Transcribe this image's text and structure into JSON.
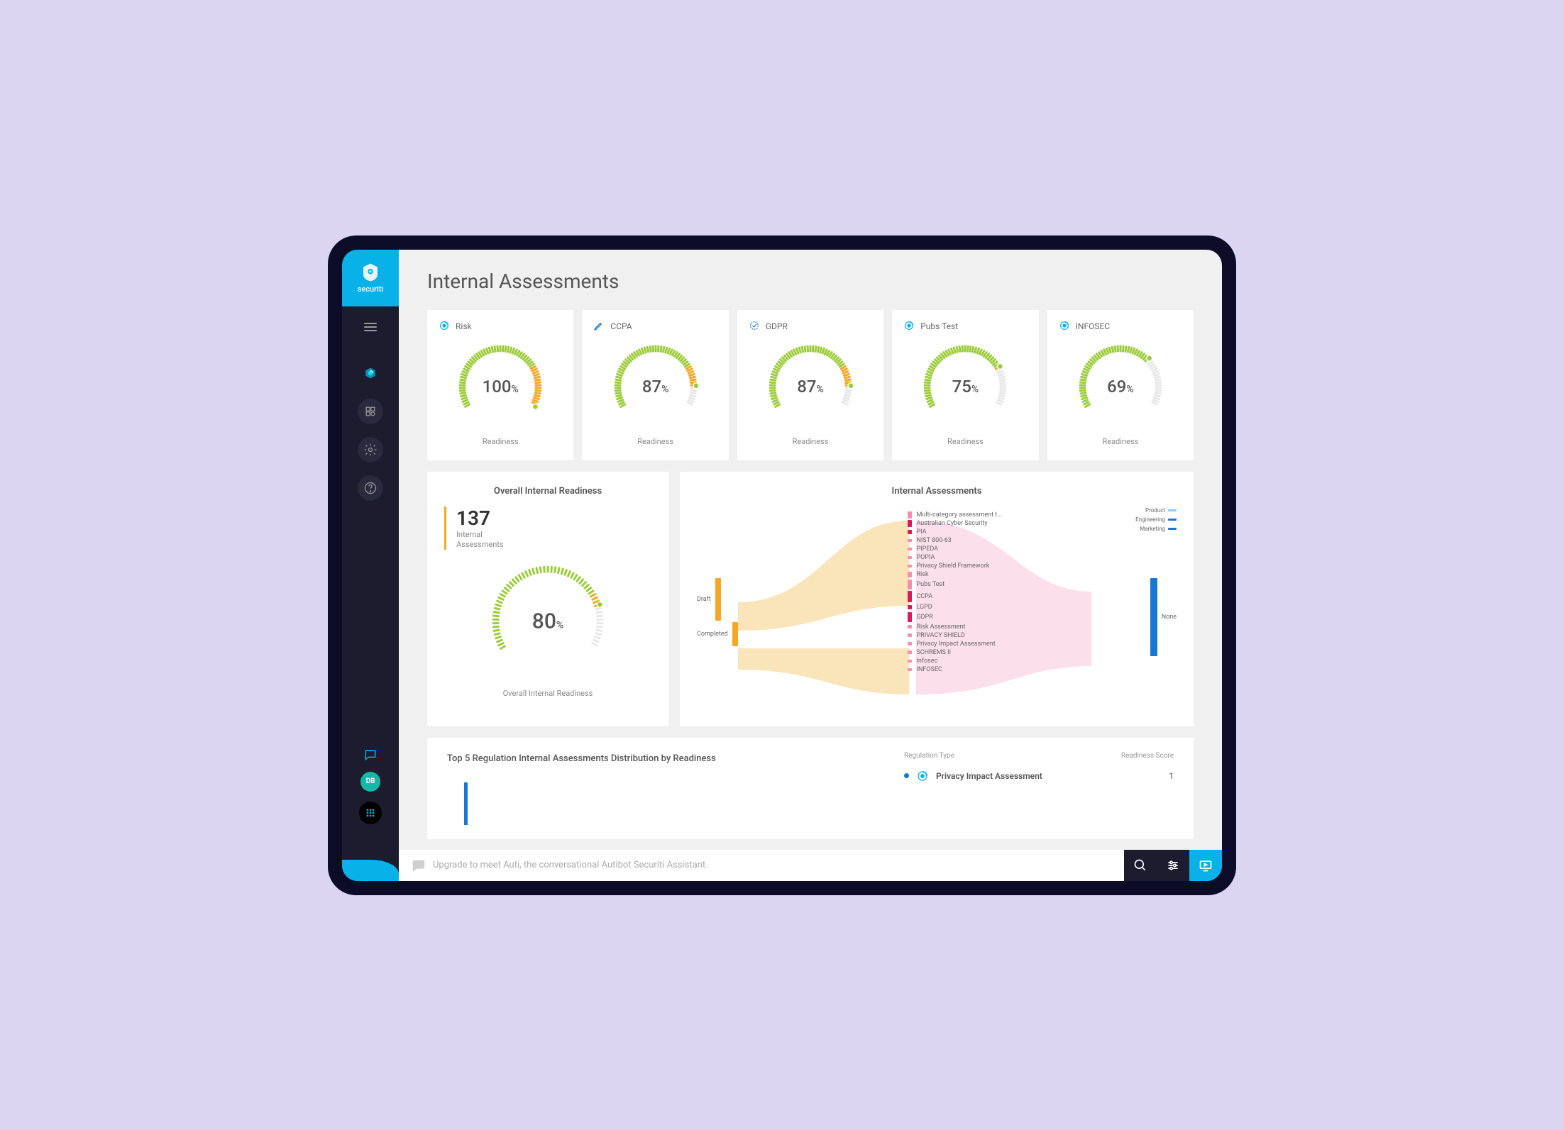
{
  "brand": {
    "name": "securiti"
  },
  "page": {
    "title": "Internal Assessments"
  },
  "sidebar": {
    "avatar_initials": "DB"
  },
  "readiness_cards": [
    {
      "label": "Risk",
      "value": 100,
      "icon": "target",
      "color": "#08b1e7"
    },
    {
      "label": "CCPA",
      "value": 87,
      "icon": "pen",
      "color": "#1976d2"
    },
    {
      "label": "GDPR",
      "value": 87,
      "icon": "check-target",
      "color": "#1976d2"
    },
    {
      "label": "Pubs Test",
      "value": 75,
      "icon": "target",
      "color": "#08b1e7"
    },
    {
      "label": "INFOSEC",
      "value": 69,
      "icon": "target",
      "color": "#08b1e7"
    }
  ],
  "readiness_label": "Readiness",
  "overall_panel": {
    "title": "Overall Internal Readiness",
    "count": 137,
    "count_label": "Internal\nAssessments",
    "value": 80,
    "label": "Overall Internal Readiness"
  },
  "sankey_panel": {
    "title": "Internal Assessments",
    "left_nodes": [
      {
        "label": "Draft",
        "size": "large"
      },
      {
        "label": "Completed",
        "size": "small"
      }
    ],
    "mid_nodes": [
      {
        "label": "Multi-category assessment t...",
        "h": 10,
        "faded": true
      },
      {
        "label": "Australian Cyber Security",
        "h": 10,
        "faded": false
      },
      {
        "label": "PIA",
        "h": 6,
        "faded": false
      },
      {
        "label": "NIST 800-63",
        "h": 4,
        "faded": true
      },
      {
        "label": "PIPEDA",
        "h": 4,
        "faded": true
      },
      {
        "label": "POPIA",
        "h": 4,
        "faded": true
      },
      {
        "label": "Privacy Shield Framework",
        "h": 4,
        "faded": true
      },
      {
        "label": "Risk",
        "h": 8,
        "faded": true
      },
      {
        "label": "Pubs Test",
        "h": 14,
        "faded": true
      },
      {
        "label": "CCPA",
        "h": 16,
        "faded": false
      },
      {
        "label": "LGPD",
        "h": 6,
        "faded": false
      },
      {
        "label": "GDPR",
        "h": 14,
        "faded": false
      },
      {
        "label": "Risk Assessment",
        "h": 5,
        "faded": true
      },
      {
        "label": "PRIVACY SHIELD",
        "h": 5,
        "faded": true
      },
      {
        "label": "Privacy Impact Assessment",
        "h": 5,
        "faded": true
      },
      {
        "label": "SCHREMS II",
        "h": 5,
        "faded": true
      },
      {
        "label": "Infosec",
        "h": 4,
        "faded": true
      },
      {
        "label": "INFOSEC",
        "h": 4,
        "faded": true
      }
    ],
    "right_nodes": [
      {
        "label": "None",
        "color": "#1976d2"
      }
    ],
    "right_small": [
      {
        "label": "Product",
        "color": "#90caf9"
      },
      {
        "label": "Engineering",
        "color": "#1976d2"
      },
      {
        "label": "Marketing",
        "color": "#1976d2"
      }
    ]
  },
  "bottom_panel": {
    "title": "Top 5 Regulation Internal Assessments Distribution by Readiness",
    "table": {
      "headers": {
        "left": "Regulation Type",
        "right": "Readiness Score"
      },
      "rows": [
        {
          "label": "Privacy Impact Assessment",
          "score": 1
        }
      ]
    }
  },
  "footer": {
    "placeholder": "Upgrade to meet Auti, the conversational Autibot Securiti Assistant."
  },
  "chart_data": [
    {
      "type": "gauge",
      "label": "Risk",
      "value": 100,
      "max": 100
    },
    {
      "type": "gauge",
      "label": "CCPA",
      "value": 87,
      "max": 100
    },
    {
      "type": "gauge",
      "label": "GDPR",
      "value": 87,
      "max": 100
    },
    {
      "type": "gauge",
      "label": "Pubs Test",
      "value": 75,
      "max": 100
    },
    {
      "type": "gauge",
      "label": "INFOSEC",
      "value": 69,
      "max": 100
    },
    {
      "type": "gauge",
      "label": "Overall Internal Readiness",
      "value": 80,
      "max": 100
    },
    {
      "type": "sankey",
      "title": "Internal Assessments",
      "nodes": [
        "Draft",
        "Completed",
        "Multi-category assessment t...",
        "Australian Cyber Security",
        "PIA",
        "NIST 800-63",
        "PIPEDA",
        "POPIA",
        "Privacy Shield Framework",
        "Risk",
        "Pubs Test",
        "CCPA",
        "LGPD",
        "GDPR",
        "Risk Assessment",
        "PRIVACY SHIELD",
        "Privacy Impact Assessment",
        "SCHREMS II",
        "Infosec",
        "INFOSEC",
        "None",
        "Product",
        "Engineering",
        "Marketing"
      ],
      "links_approx": [
        {
          "source": "Draft",
          "target": "CCPA",
          "value": 10
        },
        {
          "source": "Draft",
          "target": "GDPR",
          "value": 9
        },
        {
          "source": "Draft",
          "target": "Pubs Test",
          "value": 8
        },
        {
          "source": "Draft",
          "target": "Risk",
          "value": 5
        },
        {
          "source": "Draft",
          "target": "Australian Cyber Security",
          "value": 5
        },
        {
          "source": "Draft",
          "target": "Multi-category assessment t...",
          "value": 5
        },
        {
          "source": "Draft",
          "target": "LGPD",
          "value": 4
        },
        {
          "source": "Draft",
          "target": "PIA",
          "value": 3
        },
        {
          "source": "Draft",
          "target": "NIST 800-63",
          "value": 2
        },
        {
          "source": "Draft",
          "target": "PIPEDA",
          "value": 2
        },
        {
          "source": "Draft",
          "target": "POPIA",
          "value": 2
        },
        {
          "source": "Draft",
          "target": "Privacy Shield Framework",
          "value": 2
        },
        {
          "source": "Completed",
          "target": "Risk Assessment",
          "value": 3
        },
        {
          "source": "Completed",
          "target": "PRIVACY SHIELD",
          "value": 3
        },
        {
          "source": "Completed",
          "target": "Privacy Impact Assessment",
          "value": 3
        },
        {
          "source": "Completed",
          "target": "SCHREMS II",
          "value": 3
        },
        {
          "source": "Completed",
          "target": "Infosec",
          "value": 2
        },
        {
          "source": "Completed",
          "target": "INFOSEC",
          "value": 2
        },
        {
          "source": "CCPA",
          "target": "None",
          "value": 10
        },
        {
          "source": "GDPR",
          "target": "None",
          "value": 9
        },
        {
          "source": "Pubs Test",
          "target": "None",
          "value": 8
        },
        {
          "source": "Privacy Impact Assessment",
          "target": "Product",
          "value": 1
        },
        {
          "source": "SCHREMS II",
          "target": "Engineering",
          "value": 1
        },
        {
          "source": "INFOSEC",
          "target": "Marketing",
          "value": 1
        }
      ]
    },
    {
      "type": "bar",
      "title": "Top 5 Regulation Internal Assessments Distribution by Readiness",
      "categories": [
        "Privacy Impact Assessment"
      ],
      "values": [
        1
      ],
      "ylabel": "Readiness Score"
    }
  ]
}
